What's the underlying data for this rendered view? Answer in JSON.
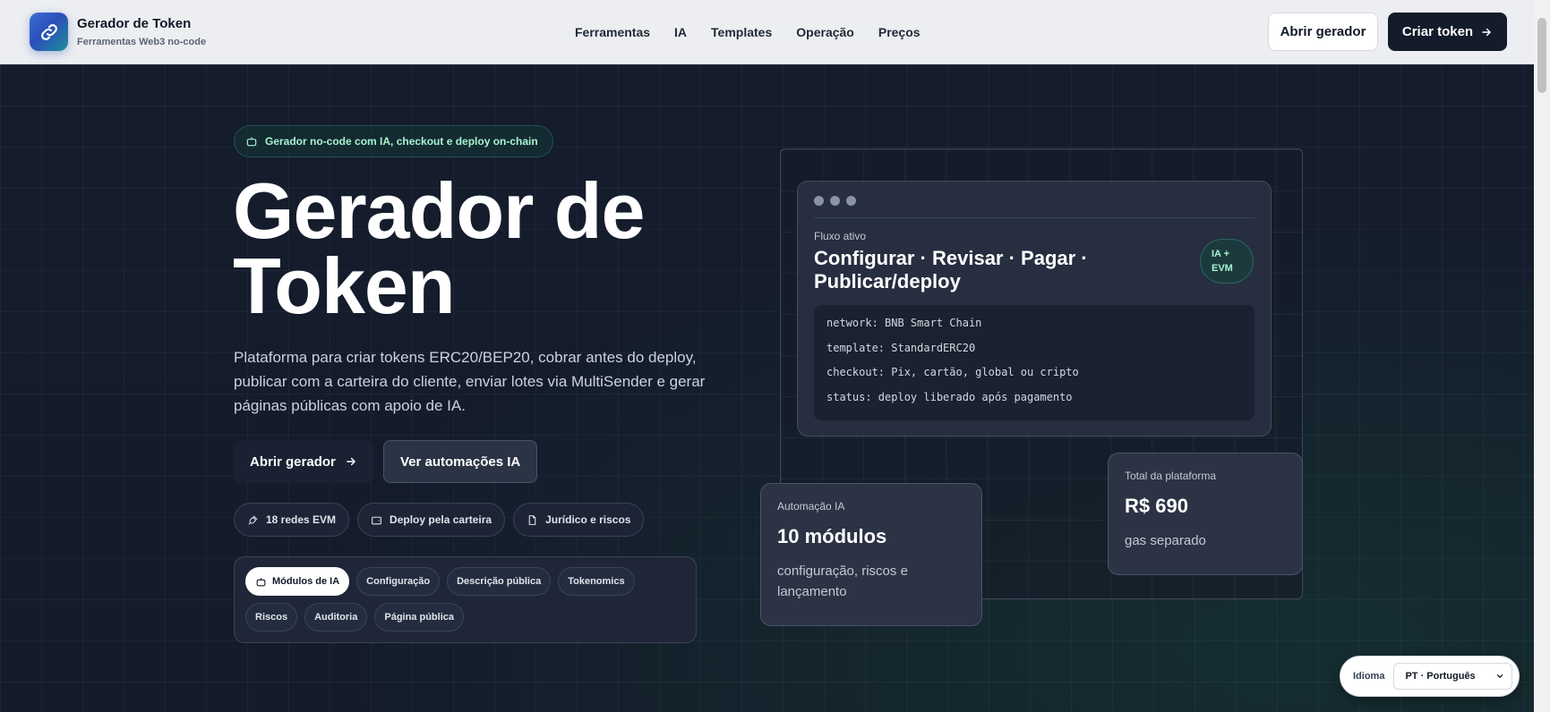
{
  "header": {
    "brand_title": "Gerador de Token",
    "brand_subtitle": "Ferramentas Web3 no-code",
    "nav": [
      "Ferramentas",
      "IA",
      "Templates",
      "Operação",
      "Preços"
    ],
    "open_generator": "Abrir gerador",
    "create_token": "Criar token"
  },
  "hero": {
    "pill": "Gerador no-code com IA, checkout e deploy on-chain",
    "title_line1": "Gerador de",
    "title_line2": "Token",
    "lead": "Plataforma para criar tokens ERC20/BEP20, cobrar antes do deploy, publicar com a carteira do cliente, enviar lotes via MultiSender e gerar páginas públicas com apoio de IA.",
    "cta_primary": "Abrir gerador",
    "cta_secondary": "Ver automações IA",
    "chips": [
      "18 redes EVM",
      "Deploy pela carteira",
      "Jurídico e riscos"
    ],
    "tabs_row1": [
      "Módulos de IA",
      "Configuração",
      "Descrição pública",
      "Tokenomics"
    ],
    "tabs_row2": [
      "Riscos",
      "Auditoria",
      "Página pública"
    ]
  },
  "flow": {
    "label": "Fluxo ativo",
    "title": "Configurar · Revisar · Pagar · Publicar/deploy",
    "badge_line1": "IA +",
    "badge_line2": "EVM",
    "code": [
      "network: BNB Smart Chain",
      "template: StandardERC20",
      "checkout: Pix, cartão, global ou cripto",
      "status: deploy liberado após pagamento"
    ]
  },
  "card_automation": {
    "label": "Automação IA",
    "value": "10 módulos",
    "note": "configuração, riscos e lançamento"
  },
  "card_total": {
    "label": "Total da plataforma",
    "value": "R$ 690",
    "note": "gas separado"
  },
  "language": {
    "label": "Idioma",
    "selected": "PT · Português"
  }
}
